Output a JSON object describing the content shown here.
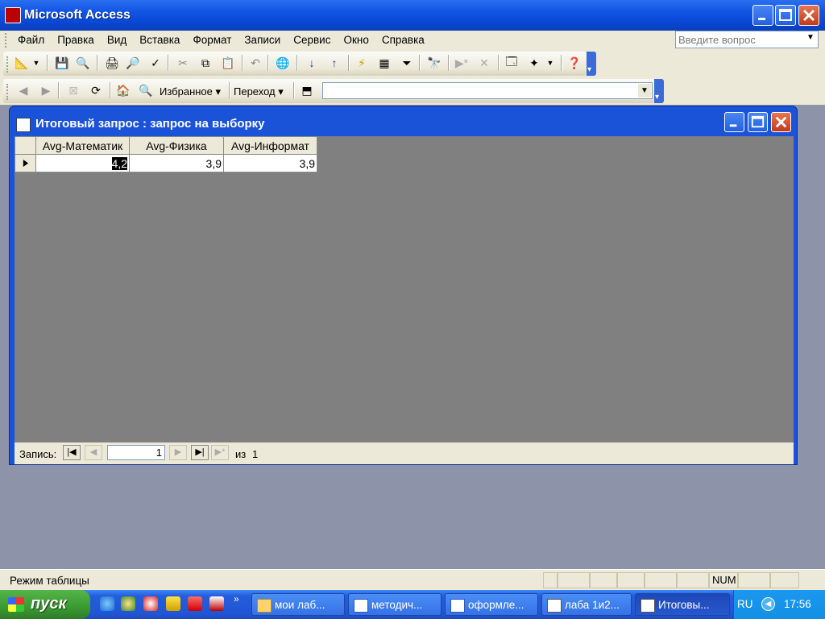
{
  "app": {
    "title": "Microsoft Access"
  },
  "menu": {
    "items": [
      "Файл",
      "Правка",
      "Вид",
      "Вставка",
      "Формат",
      "Записи",
      "Сервис",
      "Окно",
      "Справка"
    ],
    "help_placeholder": "Введите вопрос"
  },
  "web_toolbar": {
    "favorites_label": "Избранное",
    "go_label": "Переход",
    "address_value": ""
  },
  "query_window": {
    "title": "Итоговый запрос : запрос на выборку",
    "columns": [
      "Avg-Математик",
      "Avg-Физика",
      "Avg-Информат"
    ],
    "rows": [
      [
        "4,2",
        "3,9",
        "3,9"
      ]
    ],
    "nav": {
      "label": "Запись:",
      "current": "1",
      "of_label": "из",
      "total": "1"
    }
  },
  "status": {
    "text": "Режим таблицы",
    "num_indicator": "NUM"
  },
  "taskbar": {
    "start_label": "пуск",
    "tasks": [
      "мои лаб...",
      "методич...",
      "оформле...",
      "лаба 1и2...",
      "Итоговы..."
    ],
    "lang": "RU",
    "clock": "17:56"
  }
}
